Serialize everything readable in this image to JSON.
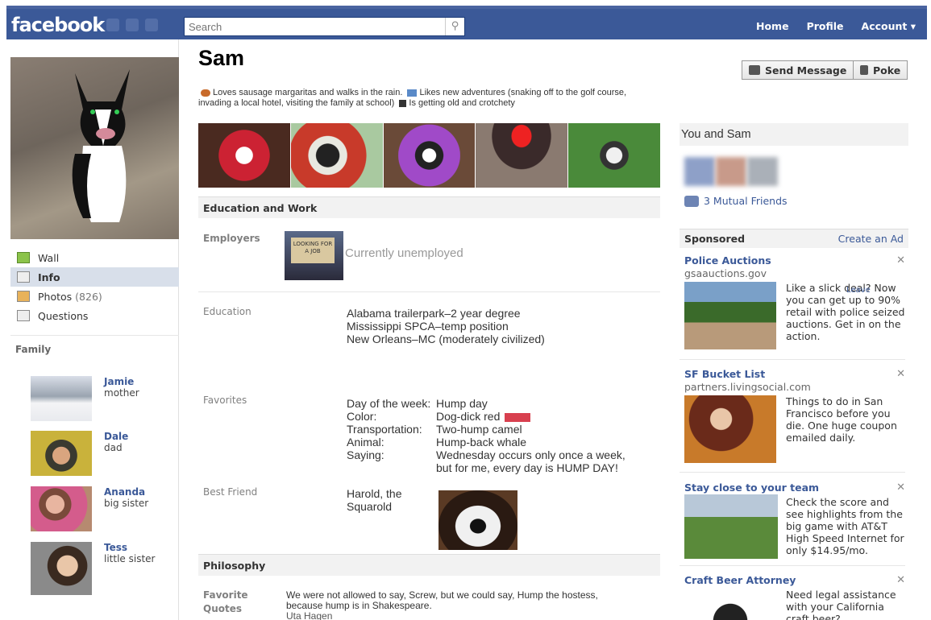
{
  "topbar": {
    "logo": "facebook",
    "search_placeholder": "Search",
    "nav": [
      "Home",
      "Profile",
      "Account ▾"
    ]
  },
  "left": {
    "nav": [
      {
        "label": "Wall",
        "count": ""
      },
      {
        "label": "Info",
        "count": ""
      },
      {
        "label": "Photos",
        "count": "(826)"
      },
      {
        "label": "Questions",
        "count": ""
      }
    ],
    "family_heading": "Family",
    "family": [
      {
        "name": "Jamie",
        "relation": "mother"
      },
      {
        "name": "Dale",
        "relation": "dad"
      },
      {
        "name": "Ananda",
        "relation": "big sister"
      },
      {
        "name": "Tess",
        "relation": "little sister"
      }
    ]
  },
  "profile": {
    "name": "Sam",
    "bio_1": "Loves sausage margaritas and walks in the rain.",
    "bio_2": "Likes new  adventures (snaking off to the golf course, invading a local hotel, visiting the family at school)",
    "bio_3": "Is getting old and crotchety"
  },
  "education_work": {
    "heading": "Education and Work",
    "employers_label": "Employers",
    "employers_value": "Currently unemployed",
    "sign_text": "LOOKING FOR A JOB",
    "education_label": "Education",
    "education": [
      "Alabama trailerpark–2 year degree",
      "Mississippi SPCA–temp position",
      "New Orleans–MC (moderately civilized)"
    ]
  },
  "favorites": {
    "label": "Favorites",
    "rows": [
      {
        "k": "Day of the week:",
        "v": "Hump day"
      },
      {
        "k": "Color:",
        "v": "Dog-dick red"
      },
      {
        "k": "Transportation:",
        "v": "Two-hump camel"
      },
      {
        "k": "Animal:",
        "v": "Hump-back whale"
      },
      {
        "k": "Saying:",
        "v": "Wednesday occurs only once a week, but for me, every day is HUMP DAY!"
      }
    ],
    "swatch_color": "#d8404f"
  },
  "best_friend": {
    "label": "Best Friend",
    "value": "Harold, the Squarold"
  },
  "philosophy": {
    "heading": "Philosophy",
    "quotes_label": "Favorite Quotes",
    "quote": "We were not allowed to say, Screw, but we could say, Hump the hostess, because hump is in Shakespeare.",
    "quote_author": "Uta Hagen"
  },
  "right": {
    "send_message": "Send Message",
    "poke": "Poke",
    "you_and": "You and Sam",
    "mutual": "3 Mutual Friends",
    "sponsored": "Sponsored",
    "create_ad": "Create an Ad",
    "ads": [
      {
        "title": "Police Auctions",
        "url": "gsaauctions.gov",
        "text": "Like a slick deal? Now you can get up to 90% retail with police seized auctions. Get in on the action."
      },
      {
        "title": "SF Bucket List",
        "url": "partners.livingsocial.com",
        "text": "Things to do in San Francisco before you die. One huge coupon emailed daily."
      },
      {
        "title": "Stay close to your team",
        "url": "",
        "text": "Check the score and see highlights from the big game with AT&T High Speed Internet for only $14.95/mo."
      },
      {
        "title": "Craft Beer Attorney",
        "url": "",
        "text": "Need legal assistance with your California craft beer?"
      }
    ],
    "leave": "Leave"
  },
  "colors": {
    "brand": "#3b5998",
    "section_bg": "#f2f2f2",
    "active_nav": "#d8dfea"
  }
}
